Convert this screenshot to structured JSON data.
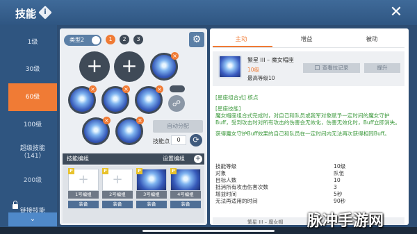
{
  "header": {
    "title": "技能",
    "info_glyph": "i",
    "close_glyph": "✕"
  },
  "sidebar": {
    "items": [
      {
        "label": "1级"
      },
      {
        "label": "30级"
      },
      {
        "label": "60级",
        "active": true
      },
      {
        "label": "100级"
      },
      {
        "label_line1": "超级技能",
        "label_line2": "（141）"
      },
      {
        "label": "200级",
        "locked": true
      },
      {
        "label": "链接技能"
      }
    ],
    "scroll_glyph": "⌄"
  },
  "loadout": {
    "type_label": "类型2",
    "slot_numbers": [
      "1",
      "2",
      "3"
    ],
    "active_slot": "1",
    "gear_glyph": "⚙",
    "add_glyph": "+",
    "remove_glyph": "×",
    "auto_assign": "自动分配",
    "skill_points_label": "技能点",
    "skill_points_value": "0",
    "refresh_glyph": "⟳"
  },
  "skill_edit": {
    "title": "技能编组",
    "set_label": "设置编组",
    "plus_glyph": "+",
    "cards": [
      {
        "badge": "P",
        "label": "1号编组",
        "equip": "装备",
        "filled": false
      },
      {
        "badge": "P",
        "label": "2号编组",
        "equip": "装备",
        "filled": false
      },
      {
        "badge": "P",
        "label": "3号编组",
        "equip": "装备",
        "filled": true
      },
      {
        "badge": "P",
        "label": "4号编组",
        "equip": "装备",
        "filled": true
      }
    ]
  },
  "detail": {
    "tabs": [
      "主动",
      "增益",
      "被动"
    ],
    "active_tab": "主动",
    "skill_name": "繁星 III – 魔女帽座",
    "level": "10级",
    "max_level": "最高等级10",
    "record_label": "查看拉记录",
    "upgrade_label": "提升",
    "desc_tag": "[星座组合式] 核点",
    "desc_section": "[星座技能]",
    "desc_body": "魔女帽座组合式完成时，对自己和队员或我军对象赋予一定时间的魔女守护Buff，受到攻击时对所有攻击的伤害会无效化，伤害无效化时，Buff立即消失。",
    "desc_extra": "获得魔女守护Buff效果的自己和队员在一定时间内无法再次获得相同Buff。",
    "stats": [
      {
        "key": "技能等级",
        "value": "10级"
      },
      {
        "key": "对象",
        "value": "队伍"
      },
      {
        "key": "目标人数",
        "value": "10"
      },
      {
        "key": "抵消所有攻击伤害次数",
        "value": "3"
      },
      {
        "key": "增益时间",
        "value": "5秒"
      },
      {
        "key": "无法再适用的时间",
        "value": "90秒"
      }
    ],
    "next_name": "繁星 III – 魔女帽"
  },
  "watermark": "脉冲手游网",
  "colors": {
    "accent": "#f07b35",
    "nav": "#2f5580",
    "desc_green": "#3e9a3e"
  }
}
